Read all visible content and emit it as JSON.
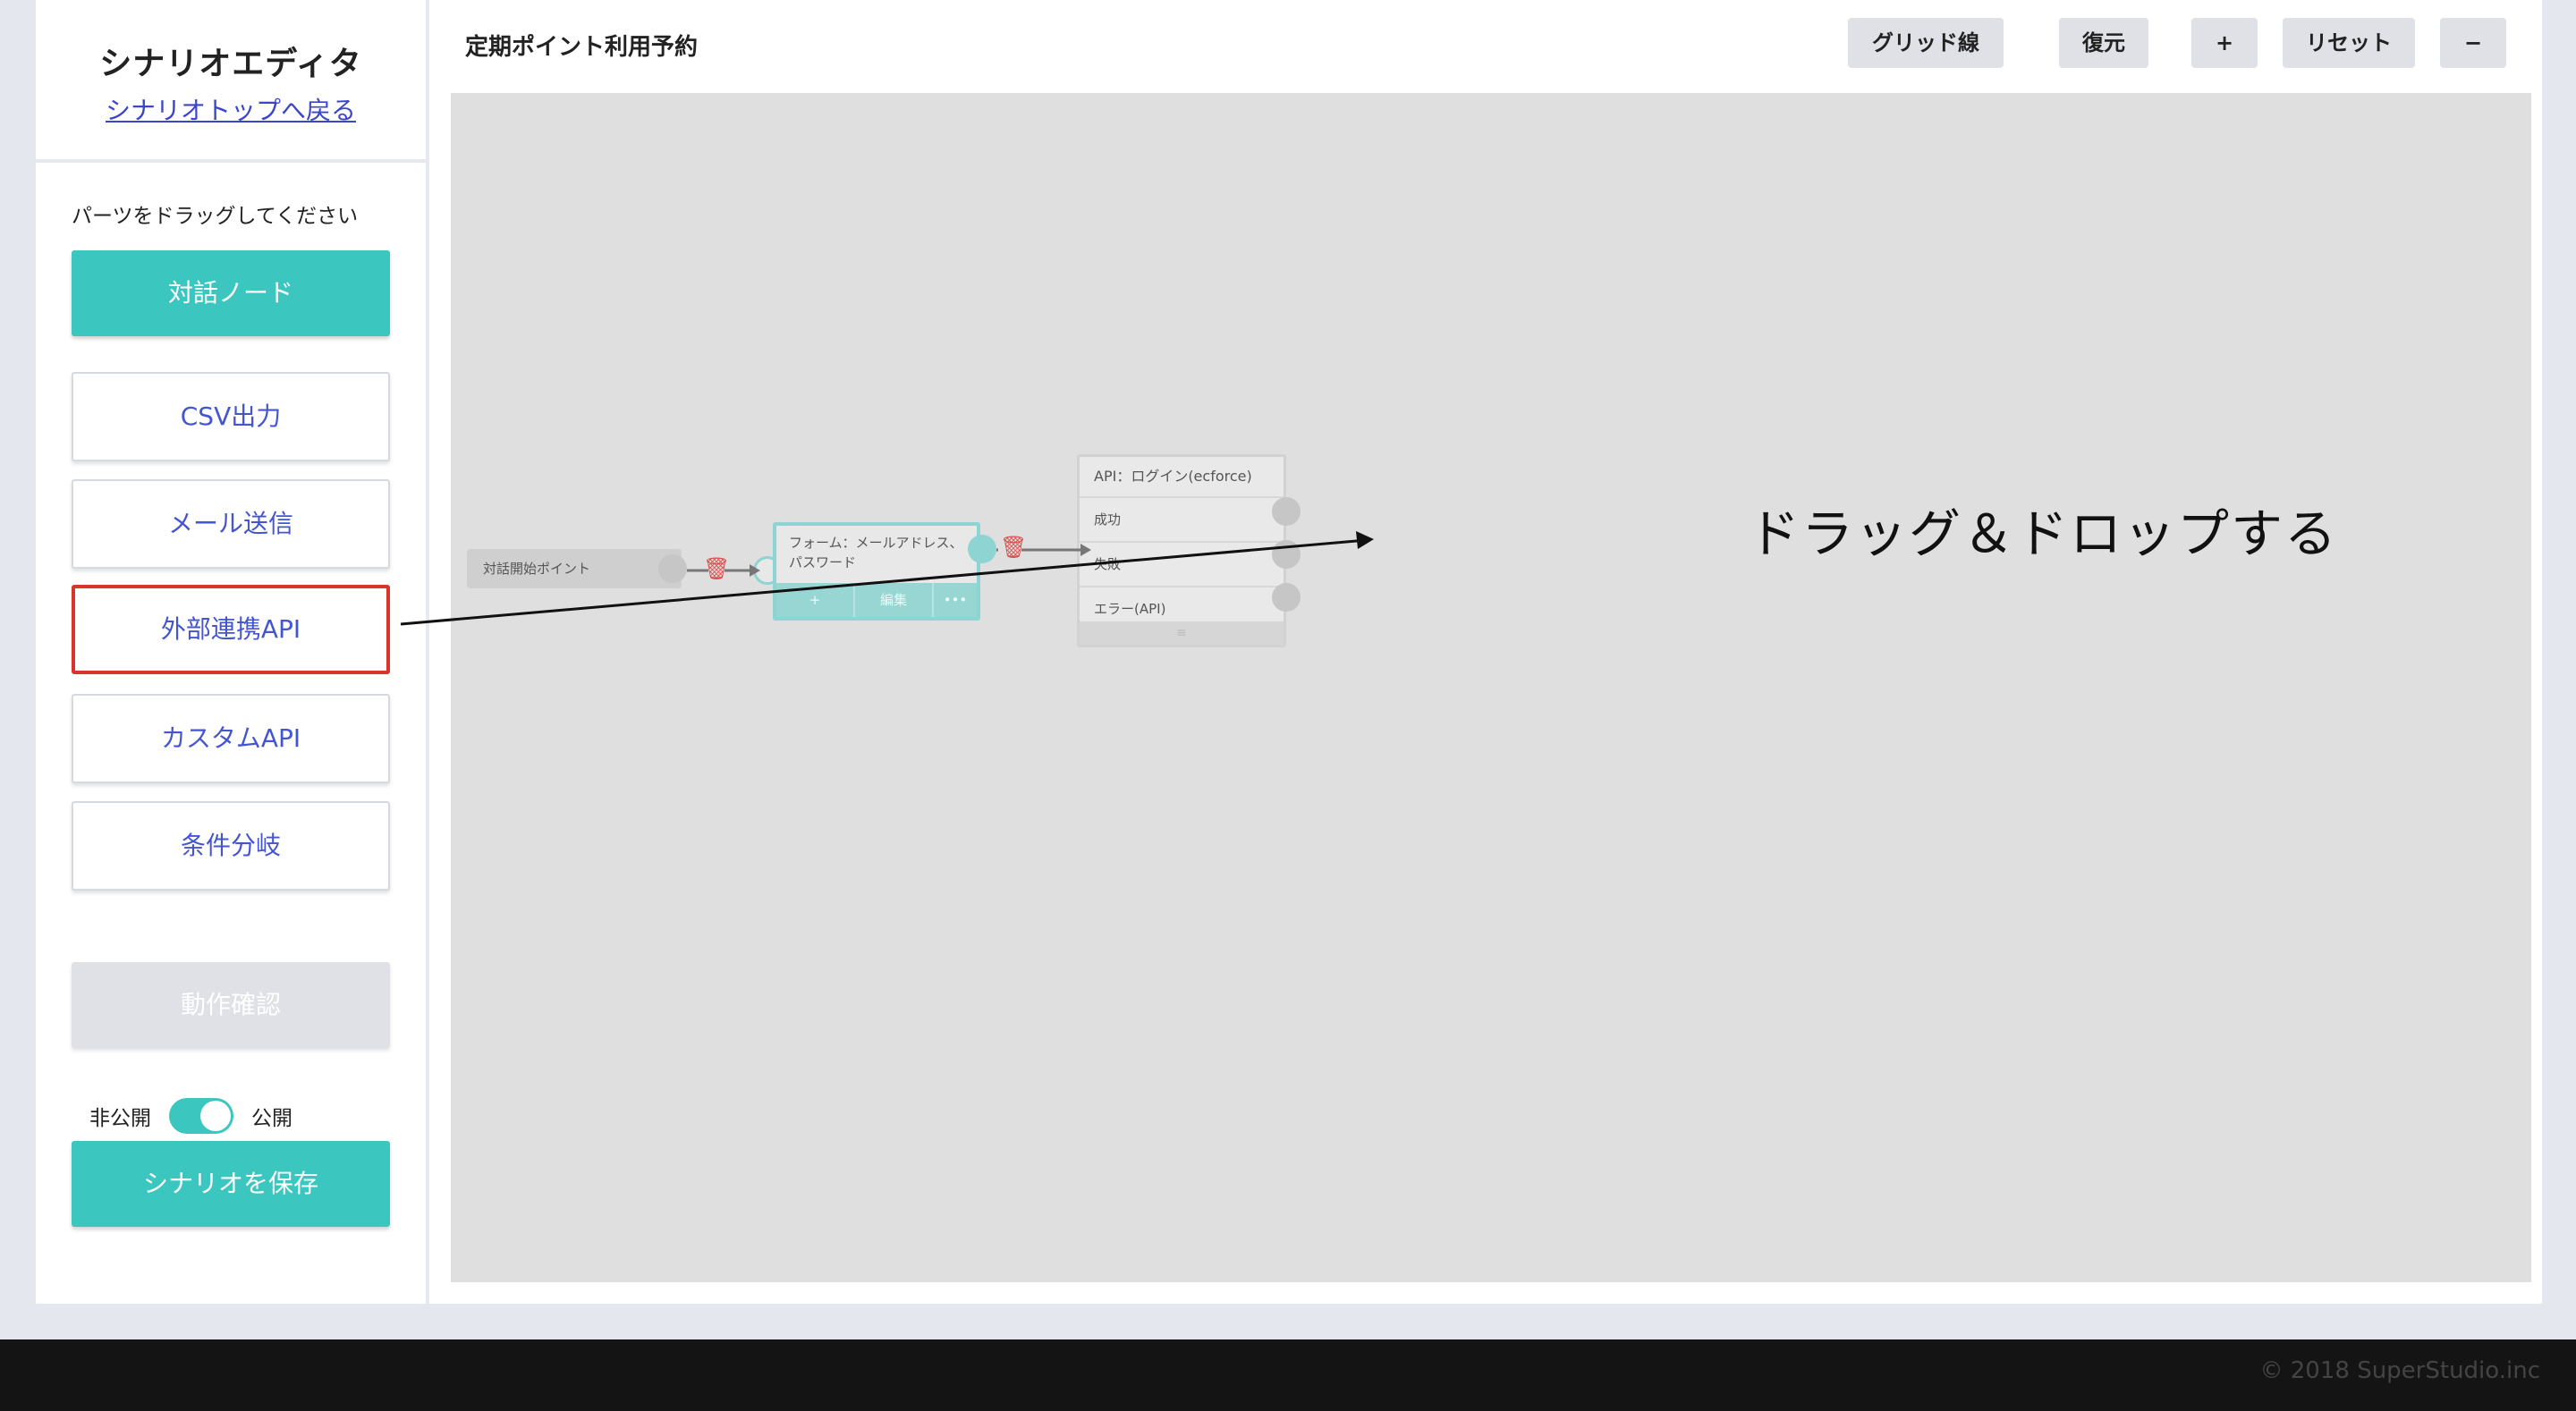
{
  "sidebar": {
    "title": "シナリオエディタ",
    "back_link": "シナリオトップへ戻る",
    "hint": "パーツをドラッグしてください",
    "parts": [
      {
        "label": "対話ノード"
      },
      {
        "label": "CSV出力"
      },
      {
        "label": "メール送信"
      },
      {
        "label": "外部連携API"
      },
      {
        "label": "カスタムAPI"
      },
      {
        "label": "条件分岐"
      }
    ],
    "verify_label": "動作確認",
    "private_label": "非公開",
    "public_label": "公開",
    "publish_toggle_on": true,
    "save_label": "シナリオを保存"
  },
  "header": {
    "title": "定期ポイント利用予約",
    "buttons": {
      "grid": "グリッド線",
      "restore": "復元",
      "zoom_in": "+",
      "reset": "リセット",
      "zoom_out": "−"
    }
  },
  "canvas": {
    "start_node": "対話開始ポイント",
    "form_node": {
      "text": "フォーム：メールアドレス、パスワード",
      "add_label": "+",
      "edit_label": "編集",
      "more_label": "•••"
    },
    "api_node": {
      "title": "API：ログイン(ecforce)",
      "outputs": [
        "成功",
        "失敗",
        "エラー(API)"
      ],
      "handle_icon": "≡"
    },
    "instruction": "ドラッグ＆ドロップする"
  },
  "footer": {
    "copyright": "© 2018 SuperStudio.inc"
  },
  "colors": {
    "accent": "#3cc6c0",
    "link": "#3b45c9",
    "part_text": "#4455d0",
    "highlight": "#d9342a",
    "canvas_bg": "#dfdfdf",
    "delete": "#d9534f"
  },
  "icons": {
    "trash": "trash-icon",
    "arrow": "arrow-right-icon"
  }
}
